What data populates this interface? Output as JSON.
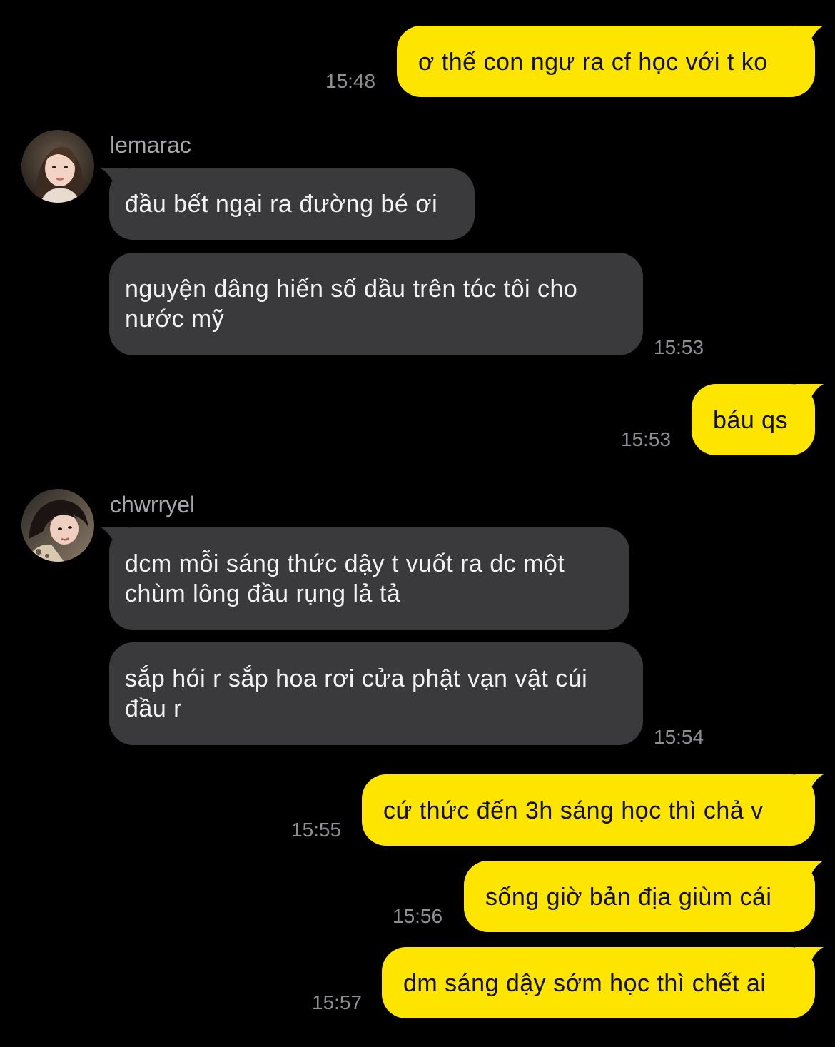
{
  "colors": {
    "background": "#000000",
    "outgoing_bubble": "#FEE500",
    "incoming_bubble": "#3A3A3C",
    "timestamp": "#8E8E93",
    "sender_name": "#A5A5AA"
  },
  "messages": {
    "m1": {
      "text": "ơ thế con ngư ra cf học với t ko",
      "time": "15:48"
    },
    "g1": {
      "sender": "lemarac",
      "avatar_icon": "user-avatar-icon",
      "m1": {
        "text": "đầu bết ngại ra đường bé ơi"
      },
      "m2": {
        "text": "nguyện dâng hiến số dầu trên tóc tôi cho nước mỹ",
        "time": "15:53"
      }
    },
    "m2": {
      "text": "báu qs",
      "time": "15:53"
    },
    "g2": {
      "sender": "chwrryel",
      "avatar_icon": "user-avatar-icon",
      "m1": {
        "text": "dcm mỗi sáng thức dậy t vuốt ra dc một chùm lông đầu rụng lả tả"
      },
      "m2": {
        "text": "sắp hói r sắp hoa rơi cửa phật vạn vật cúi đầu r",
        "time": "15:54"
      }
    },
    "m3": {
      "text": "cứ thức đến 3h sáng học thì chả v",
      "time": "15:55"
    },
    "m4": {
      "text": "sống giờ bản địa giùm cái",
      "time": "15:56"
    },
    "m5": {
      "text": "dm sáng dậy sớm học thì chết ai",
      "time": "15:57"
    }
  }
}
